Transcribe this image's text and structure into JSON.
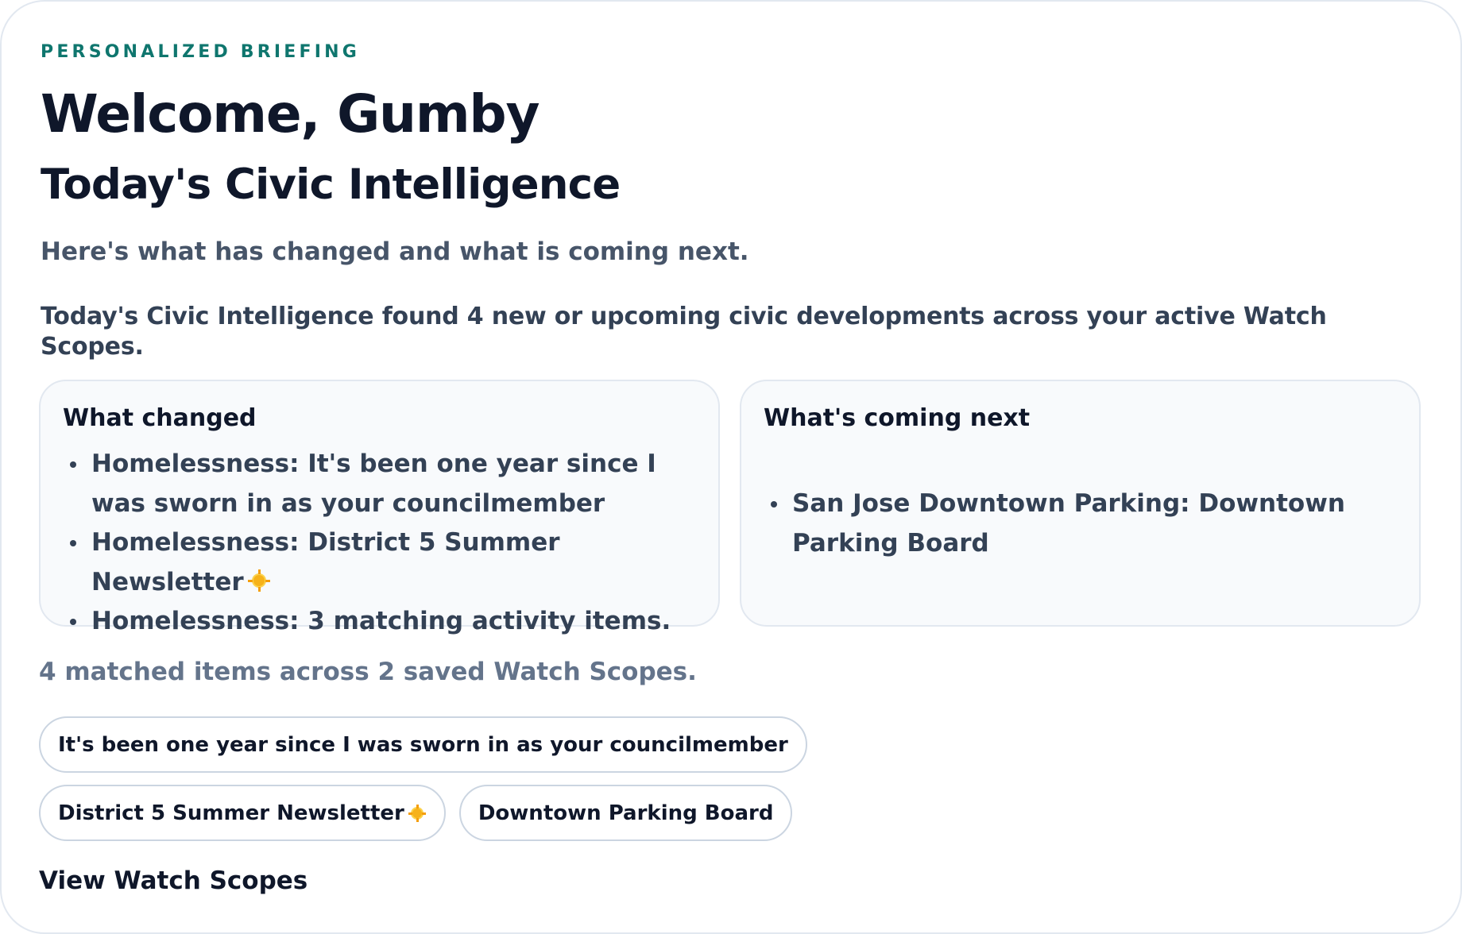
{
  "briefing": {
    "eyebrow": "PERSONALIZED BRIEFING",
    "welcome": "Welcome, Gumby",
    "title": "Today's Civic Intelligence",
    "lede": "Here's what has changed and what is coming next.",
    "summary": "Today's Civic Intelligence found 4 new or upcoming civic developments across your active Watch Scopes."
  },
  "what_changed": {
    "title": "What changed",
    "items": [
      "Homelessness: It's been one year since I was sworn in as your councilmember",
      "Homelessness: District 5 Summer Newsletter",
      "Homelessness: 3 matching activity items."
    ]
  },
  "whats_next": {
    "title": "What's coming next",
    "items": [
      "San Jose Downtown Parking: Downtown Parking Board"
    ]
  },
  "matched_summary": "4 matched items across 2 saved Watch Scopes.",
  "chips": [
    "It's been one year since I was sworn in as your councilmember",
    "District 5 Summer Newsletter",
    "Downtown Parking Board"
  ],
  "view_link": "View Watch Scopes",
  "icons": {
    "newsletter_icon": "sun-emoji-icon"
  },
  "colors": {
    "eyebrow": "#0f766e",
    "heading": "#0f172a",
    "body": "#334155",
    "muted": "#64748b",
    "panel_bg": "#f8fafc",
    "border": "#e2e8f0"
  }
}
